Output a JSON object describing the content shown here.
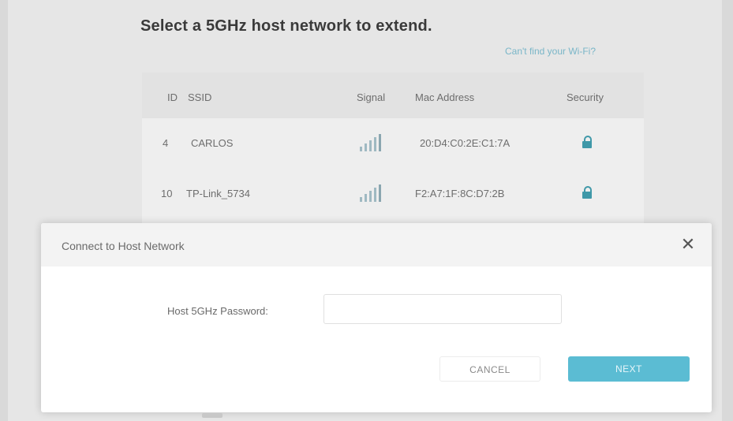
{
  "page": {
    "heading": "Select a 5GHz host network to extend.",
    "cant_find_link": "Can't find your Wi-Fi?"
  },
  "table": {
    "columns": [
      "ID",
      "SSID",
      "Signal",
      "Mac Address",
      "Security"
    ],
    "rows": [
      {
        "id": "4",
        "ssid": "CARLOS",
        "mac": "20:D4:C0:2E:C1:7A",
        "security_icon": "lock-icon"
      },
      {
        "id": "10",
        "ssid": "TP-Link_5734",
        "mac": "F2:A7:1F:8C:D7:2B",
        "security_icon": "lock-icon"
      }
    ]
  },
  "modal": {
    "title": "Connect to Host Network",
    "close_icon": "close-icon",
    "field_label": "Host 5GHz Password:",
    "field_value": "",
    "cancel_label": "CANCEL",
    "next_label": "NEXT"
  },
  "colors": {
    "accent": "#5bbcd3",
    "lock": "#3f98a8",
    "link": "#7ab6c8"
  }
}
